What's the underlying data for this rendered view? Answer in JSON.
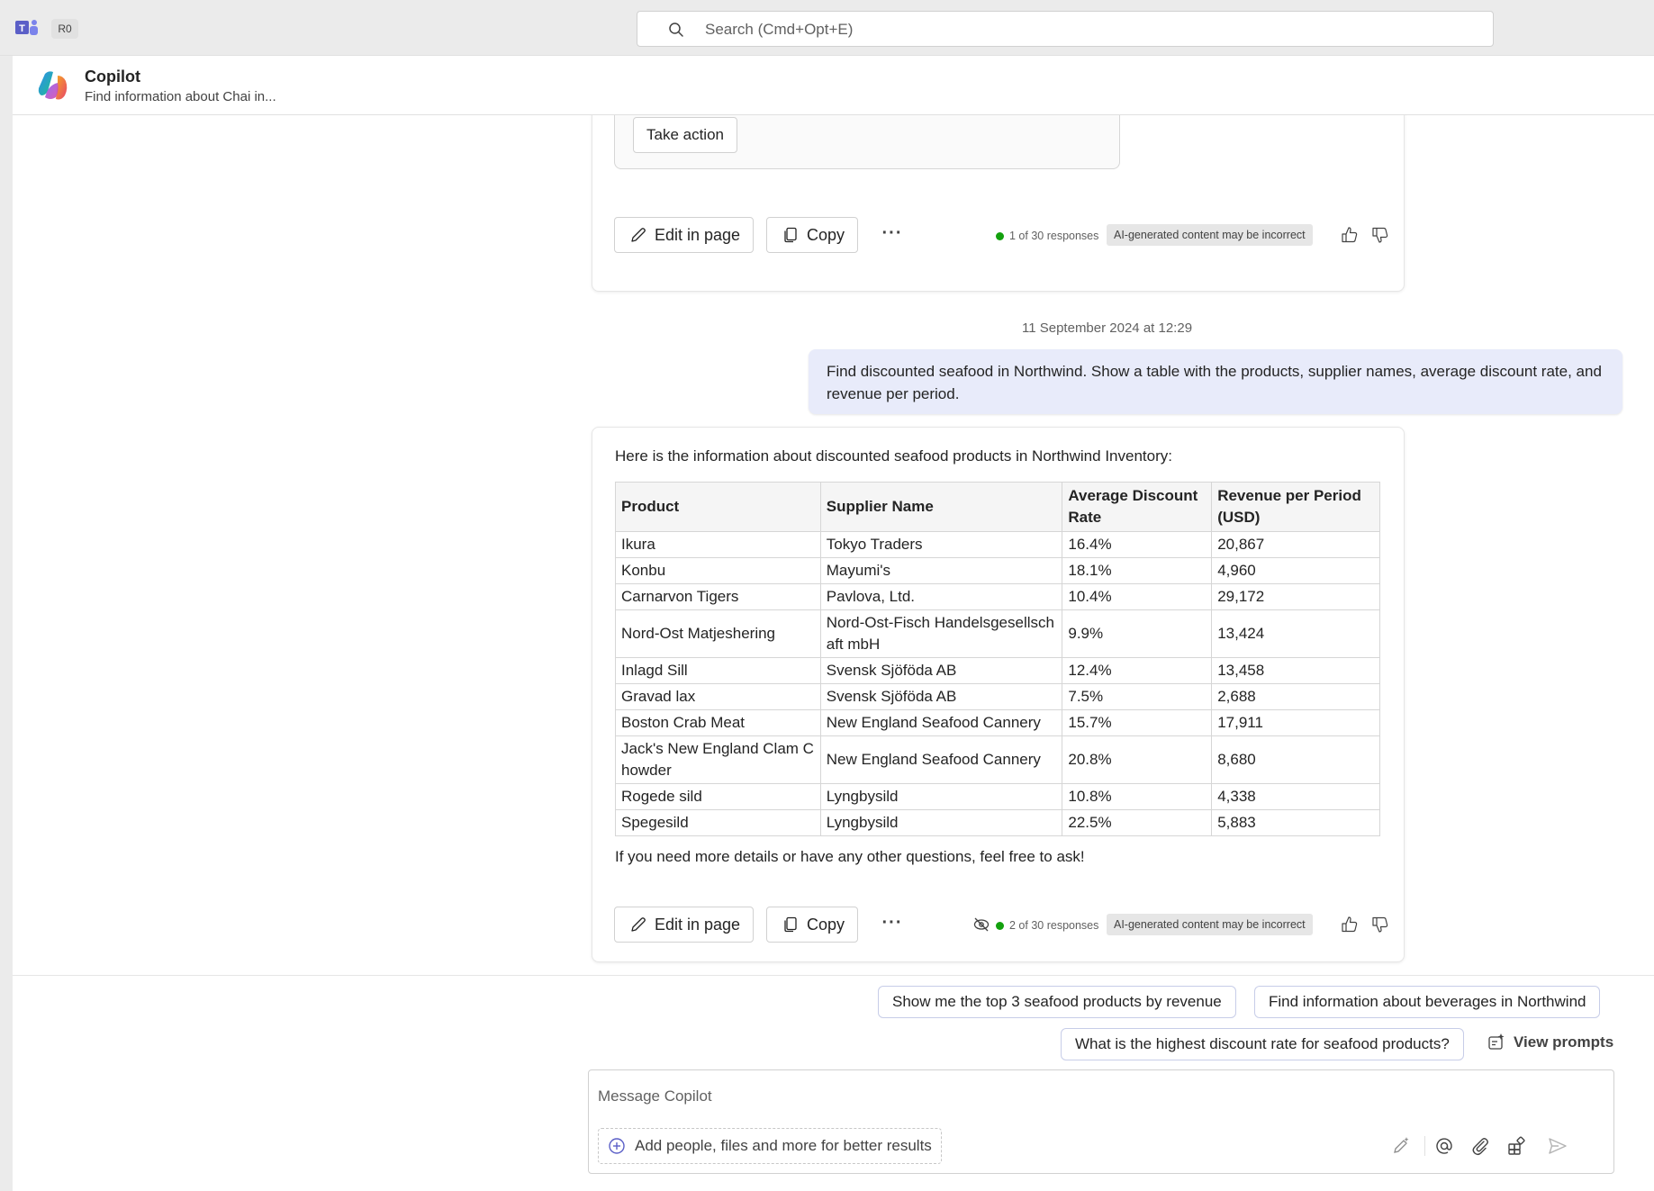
{
  "topbar": {
    "account_badge": "R0",
    "search_placeholder": "Search (Cmd+Opt+E)"
  },
  "header": {
    "title": "Copilot",
    "subtitle": "Find information about Chai in..."
  },
  "first_response": {
    "take_action_label": "Take action",
    "edit_label": "Edit in page",
    "copy_label": "Copy",
    "more_label": "···",
    "response_count": "1 of 30 responses",
    "ai_disclaimer": "AI-generated content may be incorrect"
  },
  "timestamp": "11 September 2024 at 12:29",
  "user_message": "Find discounted seafood in Northwind. Show a table with the products, supplier names, average discount rate, and revenue per period.",
  "second_response": {
    "intro": "Here is the information about discounted seafood products in Northwind Inventory:",
    "columns": [
      "Product",
      "Supplier Name",
      "Average Discount Rate",
      "Revenue per Period (USD)"
    ],
    "rows": [
      [
        "Ikura",
        "Tokyo Traders",
        "16.4%",
        "20,867"
      ],
      [
        "Konbu",
        "Mayumi's",
        "18.1%",
        "4,960"
      ],
      [
        "Carnarvon Tigers",
        "Pavlova, Ltd.",
        "10.4%",
        "29,172"
      ],
      [
        "Nord-Ost Matjeshering",
        "Nord-Ost-Fisch Handelsgesellschaft mbH",
        "9.9%",
        "13,424"
      ],
      [
        "Inlagd Sill",
        "Svensk Sjöföda AB",
        "12.4%",
        "13,458"
      ],
      [
        "Gravad lax",
        "Svensk Sjöföda AB",
        "7.5%",
        "2,688"
      ],
      [
        "Boston Crab Meat",
        "New England Seafood Cannery",
        "15.7%",
        "17,911"
      ],
      [
        "Jack's New England Clam Chowder",
        "New England Seafood Cannery",
        "20.8%",
        "8,680"
      ],
      [
        "Rogede sild",
        "Lyngbysild",
        "10.8%",
        "4,338"
      ],
      [
        "Spegesild",
        "Lyngbysild",
        "22.5%",
        "5,883"
      ]
    ],
    "outro": "If you need more details or have any other questions, feel free to ask!",
    "edit_label": "Edit in page",
    "copy_label": "Copy",
    "more_label": "···",
    "response_count": "2 of 30 responses",
    "ai_disclaimer": "AI-generated content may be incorrect"
  },
  "suggestions": {
    "chip_1": "Show me the top 3 seafood products by revenue",
    "chip_2": "Find information about beverages in Northwind",
    "chip_3": "What is the highest discount rate for seafood products?",
    "view_prompts": "View prompts"
  },
  "compose": {
    "placeholder": "Message Copilot",
    "add_people_label": "Add people, files and more for better results"
  },
  "colors": {
    "accent": "#5b5fc7",
    "user_bubble": "#e8ebfa",
    "status_green": "#13a10e"
  }
}
